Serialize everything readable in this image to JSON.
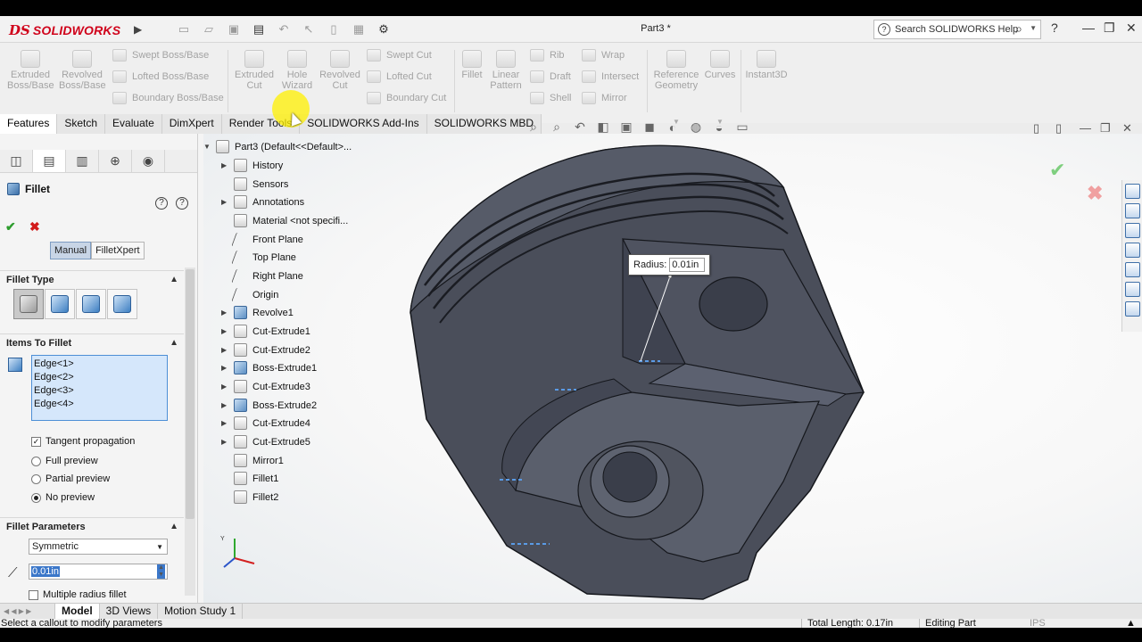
{
  "titlebar": {
    "logo_ds": "DS",
    "logo_text": "SOLIDWORKS",
    "document_title": "Part3 *",
    "search_placeholder": "Search SOLIDWORKS Help",
    "help_symbol": "?"
  },
  "ribbon": {
    "features_large": [
      {
        "label_1": "Extruded",
        "label_2": "Boss/Base"
      },
      {
        "label_1": "Revolved",
        "label_2": "Boss/Base"
      }
    ],
    "features_small": [
      "Swept Boss/Base",
      "Lofted Boss/Base",
      "Boundary Boss/Base"
    ],
    "cut_large": [
      {
        "label_1": "Extruded",
        "label_2": "Cut"
      },
      {
        "label_1": "Hole",
        "label_2": "Wizard"
      },
      {
        "label_1": "Revolved",
        "label_2": "Cut"
      }
    ],
    "cut_small": [
      "Swept Cut",
      "Lofted Cut",
      "Boundary Cut"
    ],
    "fillet_large": [
      {
        "label_1": "Fillet",
        "label_2": ""
      },
      {
        "label_1": "Linear",
        "label_2": "Pattern"
      }
    ],
    "fillet_small": [
      "Rib",
      "Draft",
      "Shell"
    ],
    "wrap_small": [
      "Wrap",
      "Intersect",
      "Mirror"
    ],
    "ref_large": [
      {
        "label_1": "Reference",
        "label_2": "Geometry"
      },
      {
        "label_1": "Curves",
        "label_2": ""
      },
      {
        "label_1": "Instant3D",
        "label_2": ""
      }
    ]
  },
  "tabs": [
    "Features",
    "Sketch",
    "Evaluate",
    "DimXpert",
    "Render Tools",
    "SOLIDWORKS Add-Ins",
    "SOLIDWORKS MBD"
  ],
  "property_manager": {
    "title": "Fillet",
    "mode_manual": "Manual",
    "mode_xpert": "FilletXpert",
    "fillet_type_header": "Fillet Type",
    "items_header": "Items To Fillet",
    "edges": [
      "Edge<1>",
      "Edge<2>",
      "Edge<3>",
      "Edge<4>"
    ],
    "tangent_propagation": "Tangent propagation",
    "full_preview": "Full preview",
    "partial_preview": "Partial preview",
    "no_preview": "No preview",
    "params_header": "Fillet Parameters",
    "symmetric": "Symmetric",
    "radius_value": "0.01in",
    "multiple_radius": "Multiple radius fillet"
  },
  "tree": {
    "root": "Part3  (Default<<Default>...",
    "items": [
      "History",
      "Sensors",
      "Annotations",
      "Material <not specifi...",
      "Front Plane",
      "Top Plane",
      "Right Plane",
      "Origin",
      "Revolve1",
      "Cut-Extrude1",
      "Cut-Extrude2",
      "Boss-Extrude1",
      "Cut-Extrude3",
      "Boss-Extrude2",
      "Cut-Extrude4",
      "Cut-Extrude5",
      "Mirror1",
      "Fillet1",
      "Fillet2"
    ]
  },
  "callout": {
    "label": "Radius:",
    "value": "0.01in"
  },
  "bottom_tabs": [
    "Model",
    "3D Views",
    "Motion Study 1"
  ],
  "status": {
    "message": "Select a callout to modify parameters",
    "total_length": "Total Length: 0.17in",
    "mode": "Editing Part",
    "units": "IPS"
  },
  "colors": {
    "model_body": "#4a4e5a",
    "selection_blue": "#4d8fd6",
    "accent_red": "#d0021b"
  }
}
